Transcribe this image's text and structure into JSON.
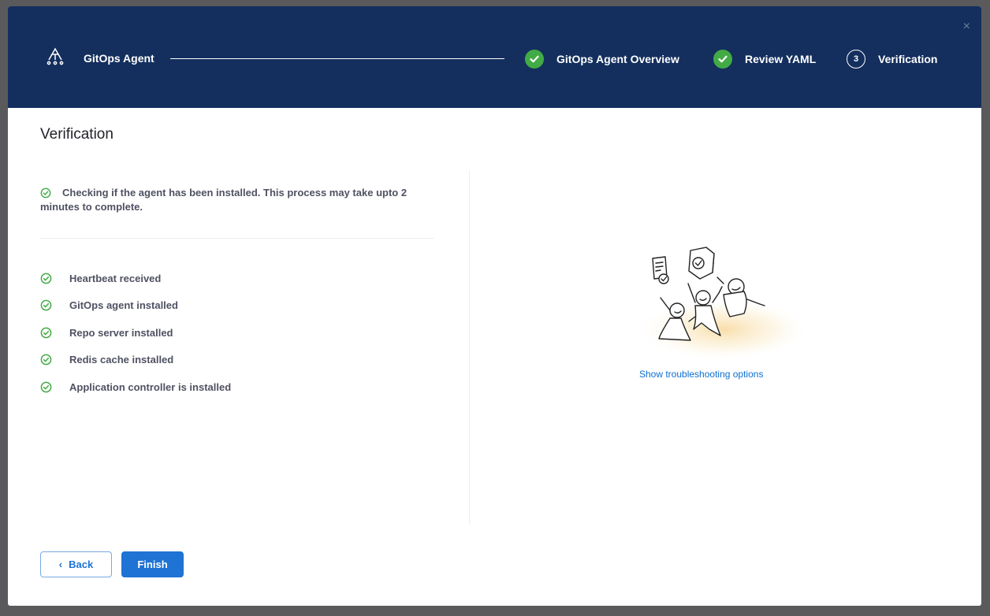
{
  "header": {
    "agent_title": "GitOps Agent",
    "close_glyph": "×",
    "steps": [
      {
        "label": "GitOps Agent Overview",
        "state": "done"
      },
      {
        "label": "Review YAML",
        "state": "done"
      },
      {
        "label": "Verification",
        "state": "current",
        "number": "3"
      }
    ]
  },
  "main": {
    "title": "Verification",
    "intro": "Checking if the agent has been installed. This process may take upto 2 minutes to complete.",
    "checks": [
      {
        "label": "Heartbeat received"
      },
      {
        "label": "GitOps agent installed"
      },
      {
        "label": "Repo server installed"
      },
      {
        "label": "Redis cache installed"
      },
      {
        "label": "Application controller is installed"
      }
    ],
    "troubleshoot_link": "Show troubleshooting options"
  },
  "footer": {
    "back_label": "Back",
    "back_chevron": "‹",
    "finish_label": "Finish"
  },
  "colors": {
    "header_bg": "#142f5e",
    "success": "#42ab45",
    "primary": "#1f73d4",
    "link": "#0b6ed0"
  }
}
